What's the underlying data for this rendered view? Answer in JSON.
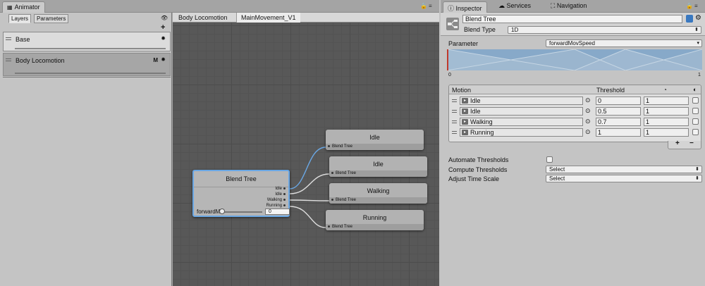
{
  "animator": {
    "tab_label": "Animator",
    "layers_tab": "Layers",
    "parameters_tab": "Parameters",
    "add_layer_symbol": "+",
    "layers": [
      {
        "name": "Base",
        "badge": ""
      },
      {
        "name": "Body Locomotion",
        "badge": "M"
      }
    ],
    "breadcrumb": [
      "Body Locomotion",
      "MainMovement_V1"
    ],
    "blend_node": {
      "title": "Blend Tree",
      "outputs": [
        "Idle",
        "Idle",
        "Walking",
        "Running"
      ],
      "param_name": "forwardM",
      "param_value": "0"
    },
    "child_nodes": [
      {
        "title": "Idle",
        "sub": "Blend Tree"
      },
      {
        "title": "Idle",
        "sub": "Blend Tree"
      },
      {
        "title": "Walking",
        "sub": "Blend Tree"
      },
      {
        "title": "Running",
        "sub": "Blend Tree"
      }
    ]
  },
  "inspector": {
    "tabs": [
      "Inspector",
      "Services",
      "Navigation"
    ],
    "name_value": "Blend Tree",
    "blend_type_label": "Blend Type",
    "blend_type_value": "1D",
    "parameter_label": "Parameter",
    "parameter_value": "forwardMovSpeed",
    "axis_min": "0",
    "axis_max": "1",
    "table": {
      "col_motion": "Motion",
      "col_threshold": "Threshold",
      "rows": [
        {
          "motion": "Idle",
          "threshold": "0",
          "speed": "1"
        },
        {
          "motion": "Idle",
          "threshold": "0.5",
          "speed": "1"
        },
        {
          "motion": "Walking",
          "threshold": "0.7",
          "speed": "1"
        },
        {
          "motion": "Running",
          "threshold": "1",
          "speed": "1"
        }
      ],
      "add_symbol": "+",
      "remove_symbol": "−"
    },
    "automate_label": "Automate Thresholds",
    "compute_label": "Compute Thresholds",
    "compute_value": "Select",
    "adjust_label": "Adjust Time Scale",
    "adjust_value": "Select"
  },
  "colors": {
    "graph_bg": "#585858",
    "selection_outline": "#6aa7e4",
    "wire": "#dedede",
    "selected_wire": "#6aa7e4",
    "blend_graph": "#87a9c9"
  }
}
